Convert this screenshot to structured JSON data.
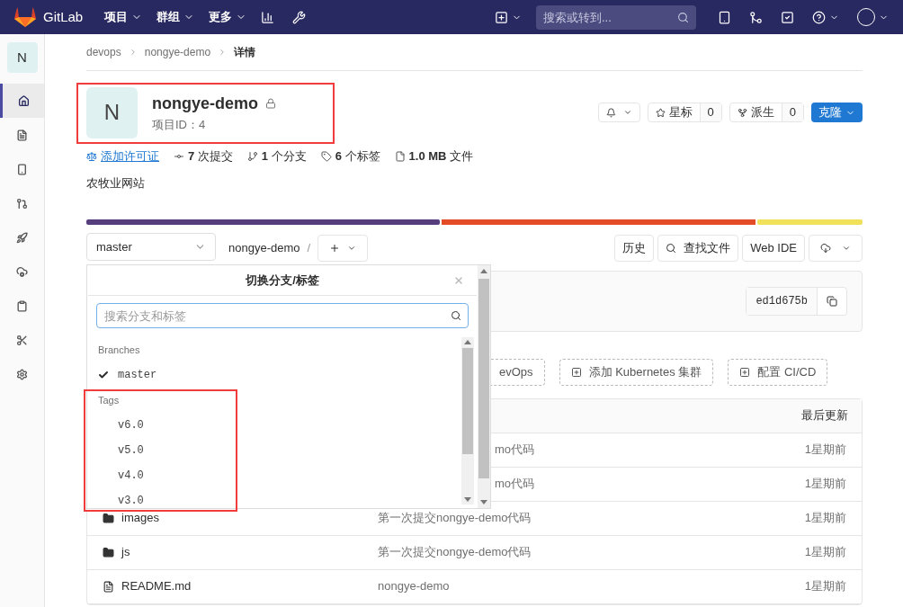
{
  "topbar": {
    "brand": "GitLab",
    "menus": [
      {
        "label": "项目"
      },
      {
        "label": "群组"
      },
      {
        "label": "更多"
      }
    ],
    "search": {
      "placeholder": "搜索或转到..."
    }
  },
  "sidebar": {
    "avatar": "N",
    "items": [
      {
        "kind": "home",
        "selected": true
      },
      {
        "kind": "file",
        "selected": false
      },
      {
        "kind": "device",
        "selected": false
      },
      {
        "kind": "merge",
        "selected": false
      },
      {
        "kind": "rocket",
        "selected": false
      },
      {
        "kind": "cloud",
        "selected": false
      },
      {
        "kind": "clipboard",
        "selected": false
      },
      {
        "kind": "scissors",
        "selected": false
      },
      {
        "kind": "settings",
        "selected": false
      }
    ]
  },
  "breadcrumb": [
    "devops",
    "nongye-demo",
    "详情"
  ],
  "project": {
    "avatar": "N",
    "name": "nongye-demo",
    "id_label": "项目ID：4",
    "private": true
  },
  "actions": {
    "star": {
      "label": "星标",
      "count": "0"
    },
    "fork": {
      "label": "派生",
      "count": "0"
    },
    "clone": "克隆"
  },
  "stats": [
    {
      "kind": "license",
      "text": "添加许可证",
      "link": true
    },
    {
      "kind": "commit",
      "bold": "7",
      "text": "次提交",
      "link": false
    },
    {
      "kind": "branch",
      "bold": "1",
      "text": "个分支",
      "link": false
    },
    {
      "kind": "tag",
      "bold": "6",
      "text": "个标签",
      "link": false
    },
    {
      "kind": "file",
      "bold": "1.0 MB",
      "text": "文件",
      "link": false
    }
  ],
  "description": "农牧业网站",
  "toolbar": {
    "branch": "master",
    "path": "nongye-demo",
    "separator": "/",
    "buttons": [
      "历史",
      "查找文件",
      "Web IDE"
    ]
  },
  "commit": {
    "sha": "ed1d675b"
  },
  "quick_actions": [
    {
      "label": "evOps",
      "icon": false
    },
    {
      "label": "添加 Kubernetes 集群",
      "icon": true
    },
    {
      "label": "配置 CI/CD",
      "icon": true
    }
  ],
  "table": {
    "last_update": "最后更新",
    "rows": [
      {
        "kind": "hidden",
        "message": "mo代码",
        "time": "1星期前"
      },
      {
        "kind": "hidden",
        "message": "mo代码",
        "time": "1星期前"
      },
      {
        "kind": "folder",
        "name": "images",
        "message": "第一次提交nongye-demo代码",
        "time": "1星期前"
      },
      {
        "kind": "folder",
        "name": "js",
        "message": "第一次提交nongye-demo代码",
        "time": "1星期前"
      },
      {
        "kind": "file",
        "name": "README.md",
        "message": "nongye-demo",
        "time": "1星期前"
      }
    ]
  },
  "dropdown": {
    "title": "切换分支/标签",
    "search_placeholder": "搜索分支和标签",
    "sections": [
      {
        "title": "Branches",
        "items": [
          {
            "label": "master",
            "selected": true
          }
        ]
      },
      {
        "title": "Tags",
        "items": [
          {
            "label": "v6.0",
            "selected": false
          },
          {
            "label": "v5.0",
            "selected": false
          },
          {
            "label": "v4.0",
            "selected": false
          },
          {
            "label": "v3.0",
            "selected": false
          }
        ]
      }
    ]
  }
}
